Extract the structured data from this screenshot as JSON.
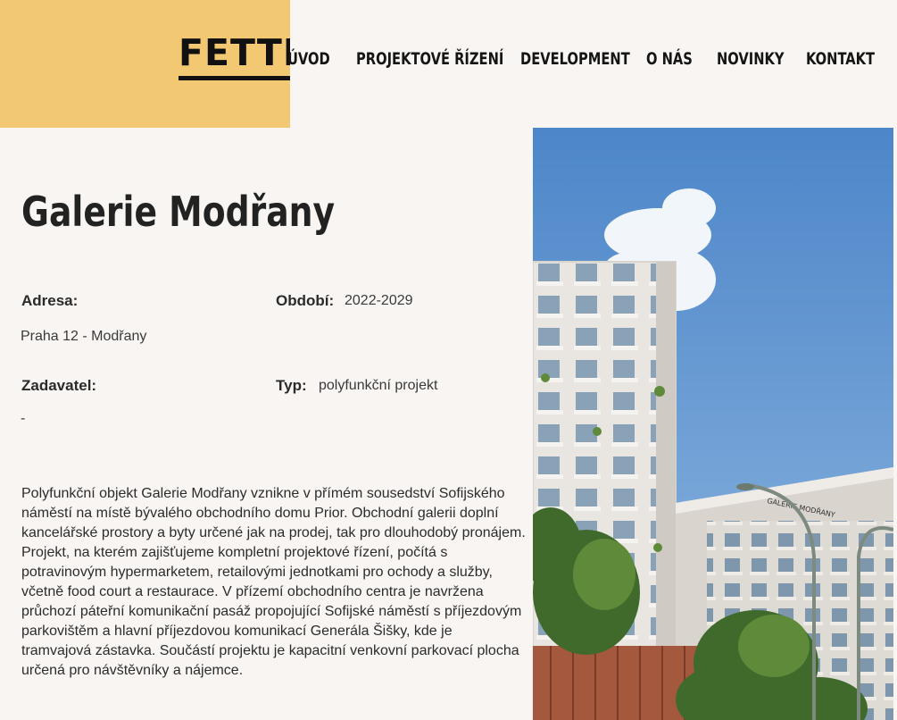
{
  "header": {
    "logo": "FETTER",
    "nav": [
      {
        "label": "ÚVOD"
      },
      {
        "label": "PROJEKTOVÉ ŘÍZENÍ"
      },
      {
        "label": "DEVELOPMENT"
      },
      {
        "label": "O NÁS"
      },
      {
        "label": "NOVINKY"
      },
      {
        "label": "KONTAKT"
      }
    ]
  },
  "project": {
    "title": "Galerie Modřany",
    "address_label": "Adresa:",
    "address_value": "Praha 12 - Modřany",
    "period_label": "Období:",
    "period_value": "2022-2029",
    "client_label": "Zadavatel:",
    "client_value": "-",
    "type_label": "Typ:",
    "type_value": "polyfunkční projekt",
    "description": "Polyfunkční objekt Galerie Modřany vznikne v přímém sousedství Sofijského náměstí na místě bývalého obchodního domu Prior. Obchodní galerii doplní kancelářské prostory a byty určené jak na prodej, tak pro dlouhodobý pronájem. Projekt, na kterém zajišťujeme kompletní projektové řízení, počítá s potravinovým hypermarketem, retailovými jednotkami pro ochody a služby, včetně food court a restaurace. V přízemí obchodního centra je navržena průchozí páteřní komunikační pasáž propojující Sofijské náměstí s příjezdovým parkovištěm a hlavní příjezdovou komunikací Generála Šišky, kde je tramvajová zástavka. Součástí projektu je kapacitní venkovní parkovací plocha určená pro návštěvníky a nájemce.",
    "building_sign": "GALERIE MODŘANY"
  },
  "colors": {
    "accent": "#f3c873",
    "background": "#f8f5f2",
    "text": "#1f1f1f"
  }
}
